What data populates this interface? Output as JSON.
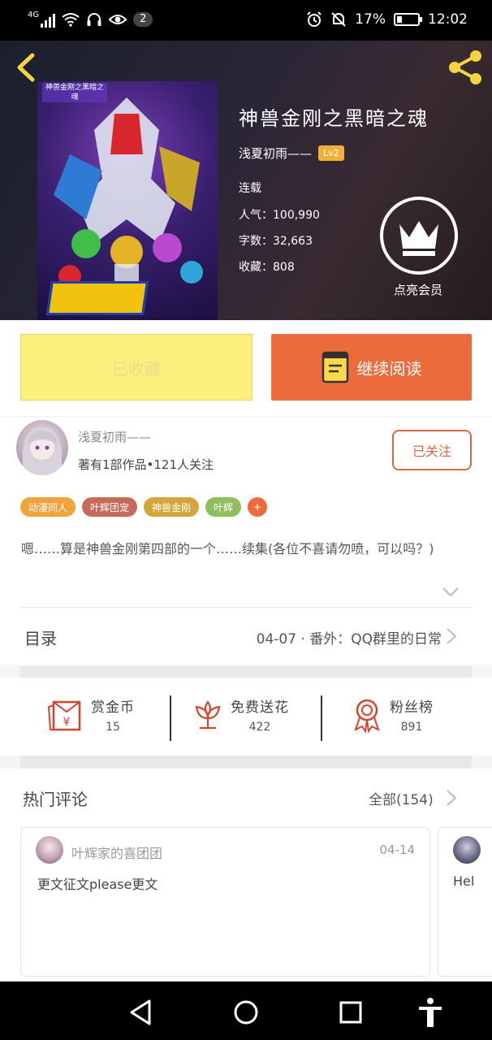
{
  "status_bar": {
    "network": "4G",
    "notification_count": "2",
    "battery": "17%",
    "time": "12:02"
  },
  "book": {
    "title": "神兽金刚之黑暗之魂",
    "author": "浅夏初雨——",
    "level": "Lv2",
    "status": "连载",
    "popularity": "人气：100,990",
    "word_count": "字数：32,663",
    "collections": "收藏：808",
    "vip_label": "点亮会员",
    "cover_caption": "神兽金刚之黑暗之魂"
  },
  "actions": {
    "favorited_label": "已收藏",
    "continue_label": "继续阅读"
  },
  "author_section": {
    "name": "浅夏初雨——",
    "stats": "著有1部作品•121人关注",
    "follow_label": "已关注"
  },
  "tags": [
    {
      "label": "动漫同人",
      "color": "#f0a23b"
    },
    {
      "label": "叶辉团宠",
      "color": "#c86a5a"
    },
    {
      "label": "神兽金刚",
      "color": "#d4a63a"
    },
    {
      "label": "叶辉",
      "color": "#8fbf5a"
    }
  ],
  "tag_more": "+",
  "description": "嗯……算是神兽金刚第四部的一个……续集(各位不喜请勿喷，可以吗？)",
  "toc": {
    "label": "目录",
    "latest_chapter": "04-07 · 番外：QQ群里的日常"
  },
  "stats": {
    "reward_label": "赏金币",
    "reward_value": "15",
    "flower_label": "免费送花",
    "flower_value": "422",
    "fans_label": "粉丝榜",
    "fans_value": "891"
  },
  "comments": {
    "label": "热门评论",
    "all_label": "全部(154)",
    "items": [
      {
        "user": "叶辉家的喜团团",
        "date": "04-14",
        "text": "更文征文please更文"
      },
      {
        "user": "",
        "date": "",
        "text": "Hel"
      }
    ]
  },
  "colors": {
    "accent": "#ec6b3c",
    "favorite_bg": "#fbf07c",
    "icon_red": "#d8442a"
  }
}
